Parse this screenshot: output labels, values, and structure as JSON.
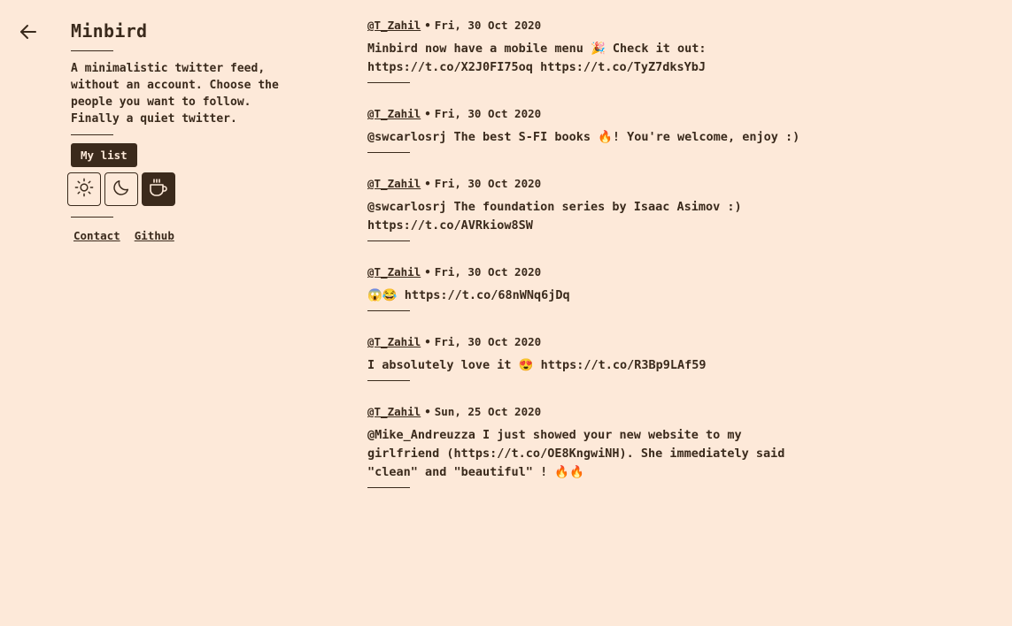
{
  "app": {
    "title": "Minbird",
    "tagline": "A minimalistic twitter feed, without an account. Choose the people you want to follow. Finally a quiet twitter.",
    "my_list_label": "My list"
  },
  "themes": [
    {
      "name": "light",
      "icon": "sun-icon",
      "active": false
    },
    {
      "name": "dark",
      "icon": "moon-icon",
      "active": false
    },
    {
      "name": "coffee",
      "icon": "coffee-cup-icon",
      "active": true
    }
  ],
  "links": {
    "contact": "Contact",
    "github": "Github"
  },
  "separator": "•",
  "tweets": [
    {
      "author": "@T_Zahil",
      "date": "Fri, 30 Oct 2020",
      "text": "Minbird now have a mobile menu 🎉 Check it out: https://t.co/X2J0FI75oq https://t.co/TyZ7dksYbJ"
    },
    {
      "author": "@T_Zahil",
      "date": "Fri, 30 Oct 2020",
      "text": "@swcarlosrj The best S-FI books 🔥! You're welcome, enjoy :)"
    },
    {
      "author": "@T_Zahil",
      "date": "Fri, 30 Oct 2020",
      "text": "@swcarlosrj The foundation series by Isaac Asimov :) https://t.co/AVRkiow8SW"
    },
    {
      "author": "@T_Zahil",
      "date": "Fri, 30 Oct 2020",
      "text": "😱😂 https://t.co/68nWNq6jDq"
    },
    {
      "author": "@T_Zahil",
      "date": "Fri, 30 Oct 2020",
      "text": "I absolutely love it 😍 https://t.co/R3Bp9LAf59"
    },
    {
      "author": "@T_Zahil",
      "date": "Sun, 25 Oct 2020",
      "text": "@Mike_Andreuzza I just showed your new website to my girlfriend (https://t.co/OE8KngwiNH). She immediately said \"clean\" and \"beautiful\" ! 🔥🔥"
    }
  ]
}
